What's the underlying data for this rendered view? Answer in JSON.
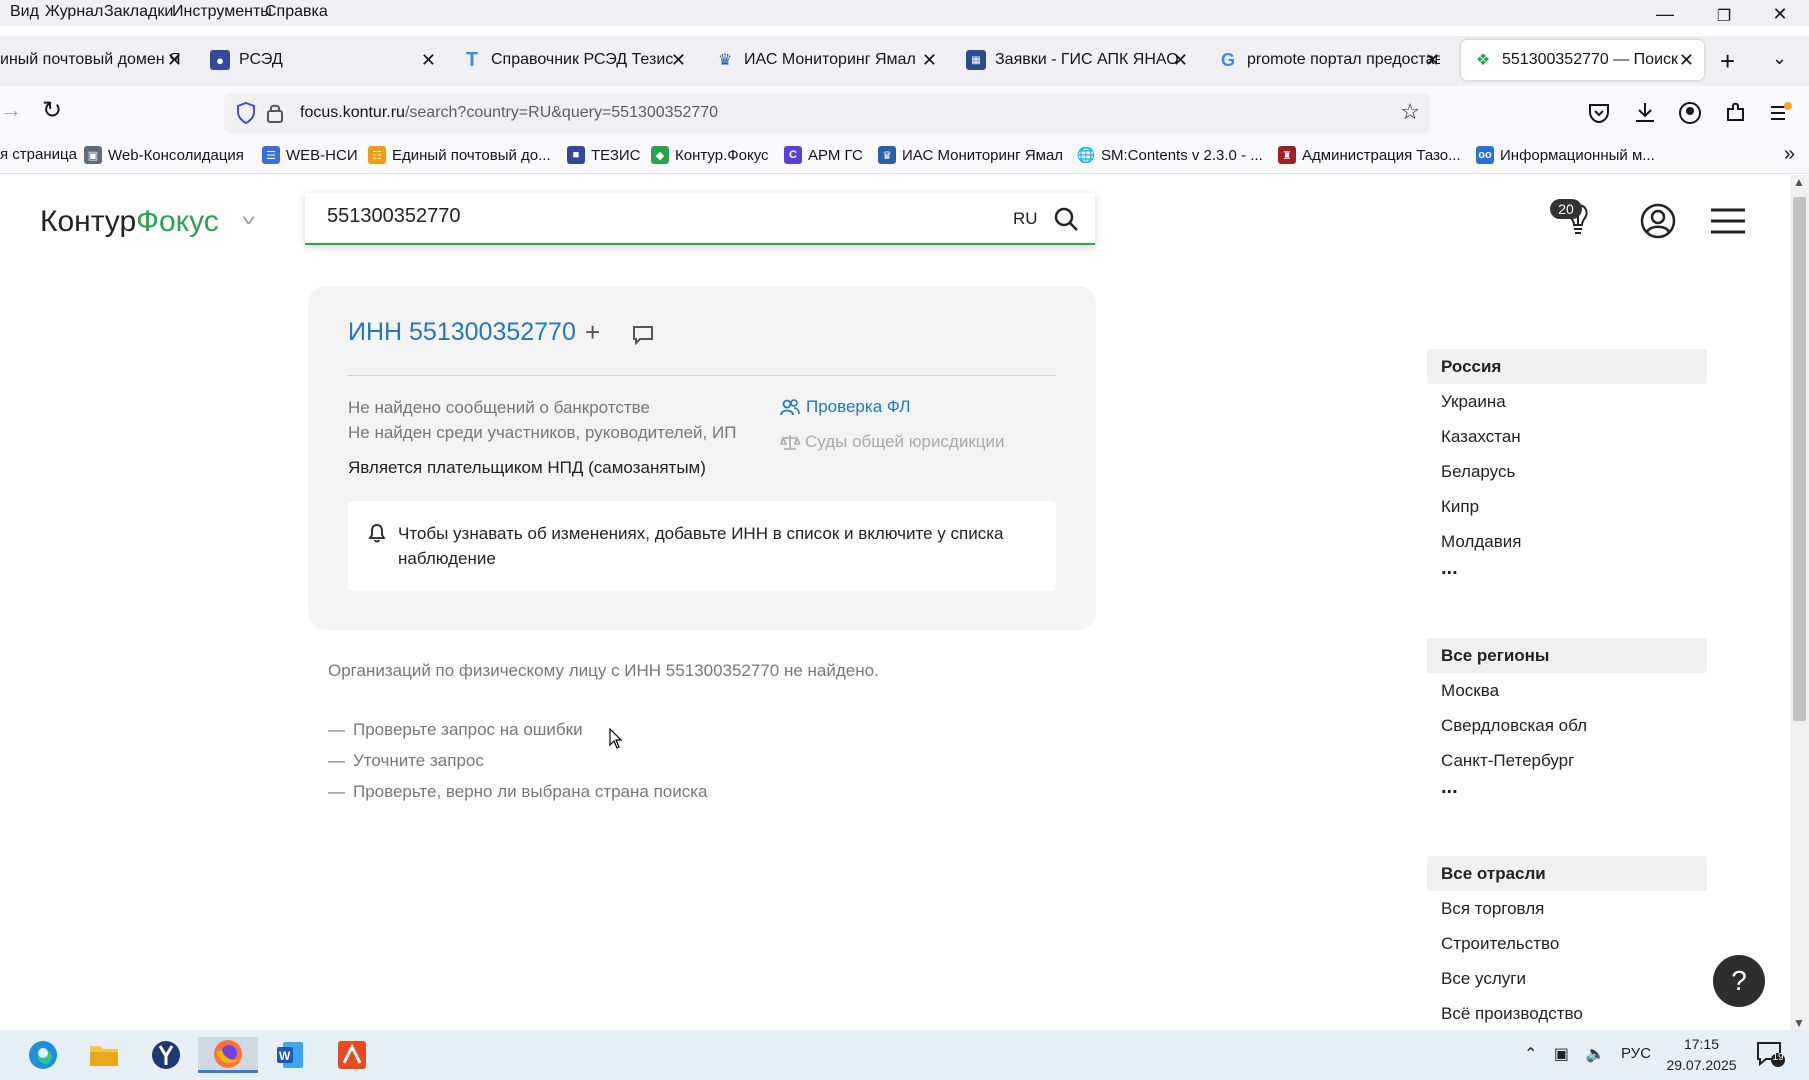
{
  "menubar": {
    "items": [
      "Вид",
      "Журнал",
      "Закладки",
      "Инструменты",
      "Справка"
    ]
  },
  "tabs": [
    {
      "label": "иный почтовый домен Я",
      "icon": "envelope-icon"
    },
    {
      "label": "РСЭД",
      "icon": "rsed-icon"
    },
    {
      "label": "Справочник РСЭД Тезис",
      "icon": "tezis-icon"
    },
    {
      "label": "ИАС Мониторинг Ямал",
      "icon": "emblem-icon"
    },
    {
      "label": "Заявки - ГИС АПК ЯНАО",
      "icon": "gis-icon"
    },
    {
      "label": "promote портал предостав",
      "icon": "google-icon"
    },
    {
      "label": "551300352770 — Поиск",
      "icon": "kontur-icon",
      "active": true
    }
  ],
  "navbar": {
    "url_host": "focus.kontur.ru",
    "url_path": "/search?country=RU&query=551300352770"
  },
  "bookmarks": [
    {
      "label": "я страница",
      "icon": ""
    },
    {
      "label": "Web-Консолидация",
      "icon": "web-icon",
      "color": "#5a6b7c"
    },
    {
      "label": "WEB-НСИ",
      "icon": "nsi-icon",
      "color": "#3a6fd8"
    },
    {
      "label": "Единый почтовый до...",
      "icon": "mail-icon",
      "color": "#f39c12"
    },
    {
      "label": "ТЕЗИС",
      "icon": "tezis-icon",
      "color": "#34499c"
    },
    {
      "label": "Контур.Фокус",
      "icon": "kontur-icon",
      "color": "#2ba24c"
    },
    {
      "label": "АРМ ГС",
      "icon": "c-icon",
      "color": "#5b3fd9"
    },
    {
      "label": "ИАС Мониторинг Ямал",
      "icon": "emblem-icon",
      "color": "#2b5fa8"
    },
    {
      "label": "SM:Contents v 2.3.0 - ...",
      "icon": "globe-icon",
      "color": "#444"
    },
    {
      "label": "Администрация Тазо...",
      "icon": "crest-icon",
      "color": "#a0202a"
    },
    {
      "label": "Информационный м...",
      "icon": "oo-icon",
      "color": "#2b6fd8"
    }
  ],
  "header": {
    "logo_main": "Контур",
    "logo_accent": "Фокус",
    "search_value": "551300352770",
    "country": "RU",
    "badge_count": "20"
  },
  "card": {
    "title": "ИНН 551300352770",
    "line1": "Не найдено сообщений о банкротстве",
    "line2": "Не найден среди участников, руководителей, ИП",
    "line3": "Является плательщиком НПД (самозанятым)",
    "check_link": "Проверка ФЛ",
    "courts": "Суды общей юрисдикции",
    "notice": "Чтобы узнавать об изменениях, добавьте ИНН в список и включите у списка наблюдение"
  },
  "results": {
    "not_found": "Организаций по физическому лицу с ИНН 551300352770 не найдено.",
    "tips": [
      "Проверьте запрос на ошибки",
      "Уточните запрос",
      "Проверьте, верно ли выбрана страна поиска"
    ]
  },
  "filters": {
    "countries": {
      "head": "Россия",
      "items": [
        "Украина",
        "Казахстан",
        "Беларусь",
        "Кипр",
        "Молдавия"
      ]
    },
    "regions": {
      "head": "Все регионы",
      "items": [
        "Москва",
        "Свердловская обл",
        "Санкт-Петербург"
      ]
    },
    "industries": {
      "head": "Все отрасли",
      "items": [
        "Вся торговля",
        "Строительство",
        "Все услуги",
        "Всё производство"
      ]
    },
    "more": "..."
  },
  "help": "?",
  "taskbar": {
    "lang": "РУС",
    "time": "17:15",
    "date": "29.07.2025",
    "notifications": "19"
  },
  "colors": {
    "accent_green": "#2ba24c",
    "link_blue": "#2378c3"
  }
}
